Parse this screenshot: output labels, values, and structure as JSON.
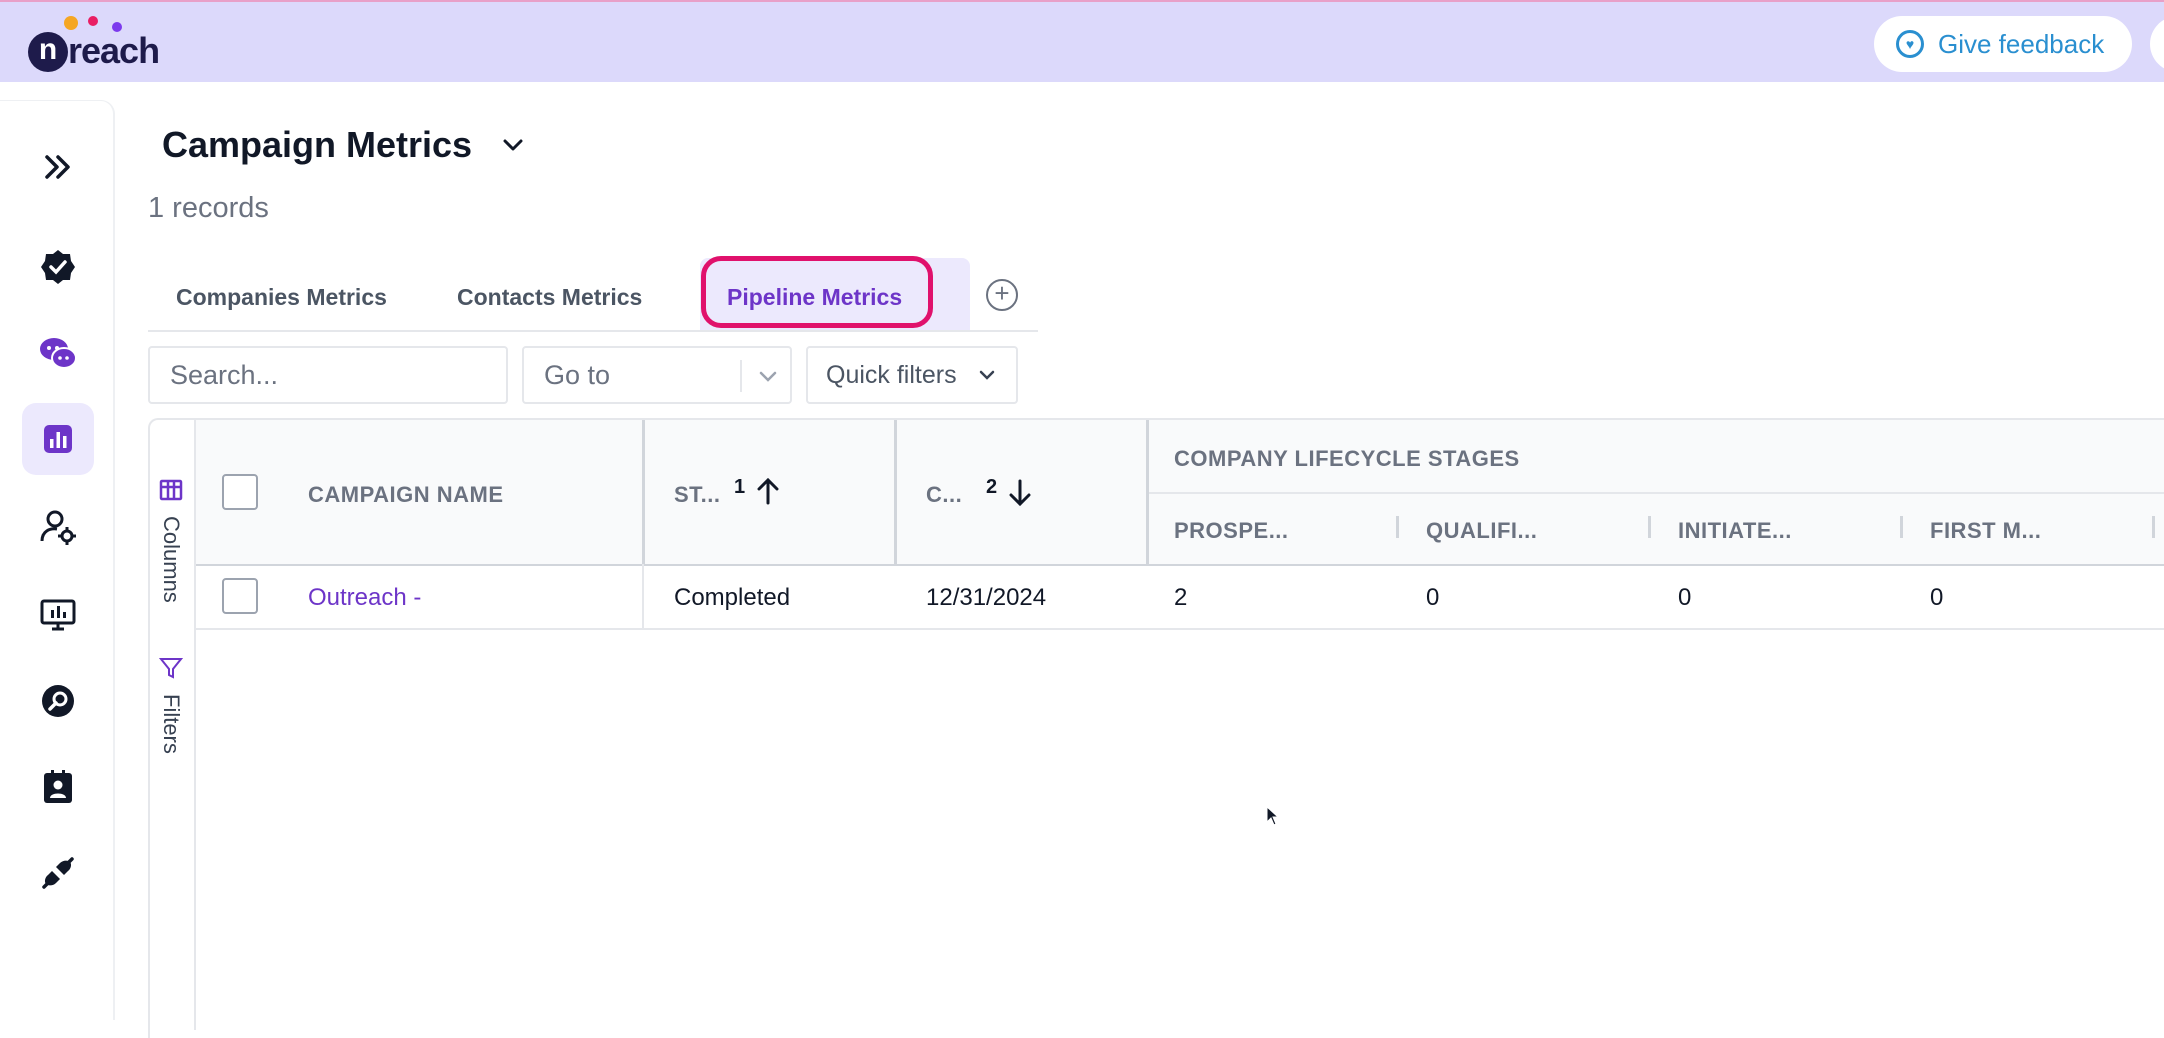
{
  "app": {
    "logo_text": "reach",
    "logo_letter": "n",
    "feedback_label": "Give feedback"
  },
  "sidebar": {
    "items": [
      {
        "name": "expand",
        "icon": "double-chevron-right-icon"
      },
      {
        "name": "tasks",
        "icon": "check-badge-icon"
      },
      {
        "name": "conversations",
        "icon": "chat-bubbles-icon"
      },
      {
        "name": "metrics",
        "icon": "bar-chart-icon",
        "active": true
      },
      {
        "name": "user-settings",
        "icon": "user-gear-icon"
      },
      {
        "name": "presentations",
        "icon": "monitor-chart-icon"
      },
      {
        "name": "search",
        "icon": "magnifier-icon"
      },
      {
        "name": "contacts",
        "icon": "contact-badge-icon"
      },
      {
        "name": "integrations",
        "icon": "plug-icon"
      }
    ]
  },
  "page": {
    "title": "Campaign Metrics",
    "records": "1 records"
  },
  "tabs": [
    {
      "label": "Companies Metrics"
    },
    {
      "label": "Contacts Metrics"
    },
    {
      "label": "Pipeline Metrics",
      "active": true
    }
  ],
  "toolbar": {
    "search_placeholder": "Search...",
    "goto_label": "Go to",
    "quick_filters_label": "Quick filters"
  },
  "grid_side": {
    "columns_label": "Columns",
    "filters_label": "Filters"
  },
  "table": {
    "headers": {
      "campaign_name": "CAMPAIGN NAME",
      "status": "ST...",
      "status_sort": "1",
      "date": "C...",
      "date_sort": "2",
      "group": "COMPANY LIFECYCLE STAGES",
      "prospect": "PROSPE...",
      "qualified": "QUALIFI...",
      "initiated": "INITIATE...",
      "first_meeting": "FIRST M..."
    },
    "rows": [
      {
        "campaign_name": "Outreach -",
        "status": "Completed",
        "date": "12/31/2024",
        "prospect": "2",
        "qualified": "0",
        "initiated": "0",
        "first_meeting": "0"
      }
    ]
  },
  "colors": {
    "accent": "#6d35c8",
    "topbar": "#dcd9fb",
    "highlight": "#e0116c",
    "feedback": "#2a8fd0"
  }
}
